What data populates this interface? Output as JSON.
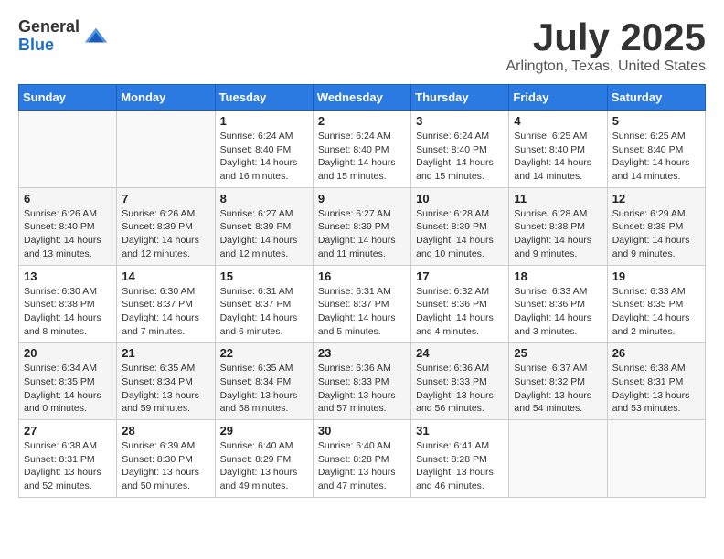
{
  "logo": {
    "general": "General",
    "blue": "Blue"
  },
  "header": {
    "month": "July 2025",
    "location": "Arlington, Texas, United States"
  },
  "weekdays": [
    "Sunday",
    "Monday",
    "Tuesday",
    "Wednesday",
    "Thursday",
    "Friday",
    "Saturday"
  ],
  "weeks": [
    [
      {
        "day": "",
        "info": ""
      },
      {
        "day": "",
        "info": ""
      },
      {
        "day": "1",
        "info": "Sunrise: 6:24 AM\nSunset: 8:40 PM\nDaylight: 14 hours and 16 minutes."
      },
      {
        "day": "2",
        "info": "Sunrise: 6:24 AM\nSunset: 8:40 PM\nDaylight: 14 hours and 15 minutes."
      },
      {
        "day": "3",
        "info": "Sunrise: 6:24 AM\nSunset: 8:40 PM\nDaylight: 14 hours and 15 minutes."
      },
      {
        "day": "4",
        "info": "Sunrise: 6:25 AM\nSunset: 8:40 PM\nDaylight: 14 hours and 14 minutes."
      },
      {
        "day": "5",
        "info": "Sunrise: 6:25 AM\nSunset: 8:40 PM\nDaylight: 14 hours and 14 minutes."
      }
    ],
    [
      {
        "day": "6",
        "info": "Sunrise: 6:26 AM\nSunset: 8:40 PM\nDaylight: 14 hours and 13 minutes."
      },
      {
        "day": "7",
        "info": "Sunrise: 6:26 AM\nSunset: 8:39 PM\nDaylight: 14 hours and 12 minutes."
      },
      {
        "day": "8",
        "info": "Sunrise: 6:27 AM\nSunset: 8:39 PM\nDaylight: 14 hours and 12 minutes."
      },
      {
        "day": "9",
        "info": "Sunrise: 6:27 AM\nSunset: 8:39 PM\nDaylight: 14 hours and 11 minutes."
      },
      {
        "day": "10",
        "info": "Sunrise: 6:28 AM\nSunset: 8:39 PM\nDaylight: 14 hours and 10 minutes."
      },
      {
        "day": "11",
        "info": "Sunrise: 6:28 AM\nSunset: 8:38 PM\nDaylight: 14 hours and 9 minutes."
      },
      {
        "day": "12",
        "info": "Sunrise: 6:29 AM\nSunset: 8:38 PM\nDaylight: 14 hours and 9 minutes."
      }
    ],
    [
      {
        "day": "13",
        "info": "Sunrise: 6:30 AM\nSunset: 8:38 PM\nDaylight: 14 hours and 8 minutes."
      },
      {
        "day": "14",
        "info": "Sunrise: 6:30 AM\nSunset: 8:37 PM\nDaylight: 14 hours and 7 minutes."
      },
      {
        "day": "15",
        "info": "Sunrise: 6:31 AM\nSunset: 8:37 PM\nDaylight: 14 hours and 6 minutes."
      },
      {
        "day": "16",
        "info": "Sunrise: 6:31 AM\nSunset: 8:37 PM\nDaylight: 14 hours and 5 minutes."
      },
      {
        "day": "17",
        "info": "Sunrise: 6:32 AM\nSunset: 8:36 PM\nDaylight: 14 hours and 4 minutes."
      },
      {
        "day": "18",
        "info": "Sunrise: 6:33 AM\nSunset: 8:36 PM\nDaylight: 14 hours and 3 minutes."
      },
      {
        "day": "19",
        "info": "Sunrise: 6:33 AM\nSunset: 8:35 PM\nDaylight: 14 hours and 2 minutes."
      }
    ],
    [
      {
        "day": "20",
        "info": "Sunrise: 6:34 AM\nSunset: 8:35 PM\nDaylight: 14 hours and 0 minutes."
      },
      {
        "day": "21",
        "info": "Sunrise: 6:35 AM\nSunset: 8:34 PM\nDaylight: 13 hours and 59 minutes."
      },
      {
        "day": "22",
        "info": "Sunrise: 6:35 AM\nSunset: 8:34 PM\nDaylight: 13 hours and 58 minutes."
      },
      {
        "day": "23",
        "info": "Sunrise: 6:36 AM\nSunset: 8:33 PM\nDaylight: 13 hours and 57 minutes."
      },
      {
        "day": "24",
        "info": "Sunrise: 6:36 AM\nSunset: 8:33 PM\nDaylight: 13 hours and 56 minutes."
      },
      {
        "day": "25",
        "info": "Sunrise: 6:37 AM\nSunset: 8:32 PM\nDaylight: 13 hours and 54 minutes."
      },
      {
        "day": "26",
        "info": "Sunrise: 6:38 AM\nSunset: 8:31 PM\nDaylight: 13 hours and 53 minutes."
      }
    ],
    [
      {
        "day": "27",
        "info": "Sunrise: 6:38 AM\nSunset: 8:31 PM\nDaylight: 13 hours and 52 minutes."
      },
      {
        "day": "28",
        "info": "Sunrise: 6:39 AM\nSunset: 8:30 PM\nDaylight: 13 hours and 50 minutes."
      },
      {
        "day": "29",
        "info": "Sunrise: 6:40 AM\nSunset: 8:29 PM\nDaylight: 13 hours and 49 minutes."
      },
      {
        "day": "30",
        "info": "Sunrise: 6:40 AM\nSunset: 8:28 PM\nDaylight: 13 hours and 47 minutes."
      },
      {
        "day": "31",
        "info": "Sunrise: 6:41 AM\nSunset: 8:28 PM\nDaylight: 13 hours and 46 minutes."
      },
      {
        "day": "",
        "info": ""
      },
      {
        "day": "",
        "info": ""
      }
    ]
  ]
}
